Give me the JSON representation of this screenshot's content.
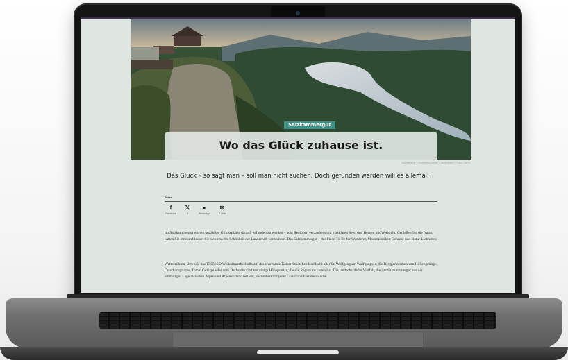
{
  "article": {
    "category": "Salzkammergut",
    "title": "Wo das Glück zuhause ist.",
    "photo_credit": "Schafberg • Himmelspforte • Mondsee • Foto: MTG",
    "subtitle": "Das Glück – so sagt man – soll man nicht suchen. Doch gefunden werden will es allemal.",
    "share": {
      "label": "Teilen",
      "items": [
        {
          "icon": "facebook-icon",
          "glyph": "f",
          "label": "Facebook"
        },
        {
          "icon": "x-icon",
          "glyph": "𝕏",
          "label": "X"
        },
        {
          "icon": "whatsapp-icon",
          "glyph": "●",
          "label": "WhatsApp"
        },
        {
          "icon": "email-icon",
          "glyph": "✉",
          "label": "E-Mail"
        }
      ]
    },
    "paragraphs": [
      "Im Salzkammergut warten unzählige Glücksplätze darauf, gefunden zu werden – acht Regionen verzaubern mit glasklaren Seen und Bergen mit Weitsicht. Genießen Sie die Natur, halten Sie inne und lassen Sie sich von der Schönheit der Landschaft verzaubern. Das Salzkammergut – der Place-To-Be für Wanderer, Mountainbiker, Genuss- und Natur-Liebhaber.",
      "Weltberühmte Orte wie das UNESCO Welkulturerbe Hallstatt, das charmante Kaiser-Städtchen Bad Ischl oder St. Wolfgang am Wolfgangsee, die Bergpanoramen von Höllengebirge, Osterhorngruppe, Totem Gebirge oder dem Dachstein sind nur einige Höhepunkte, die die Region zu bieten hat. Die landschaftliche Vielfalt, die das Salzkammergut aus der einmaligen Lage zwischen Alpen und Alpenvorland bezieht, verzaubert mit jeder Glanz und Eleinheimische."
    ]
  },
  "colors": {
    "page_bg": "#dfe6e1",
    "tag_bg": "#3e8f84",
    "title_box": "#e1e6e2"
  }
}
